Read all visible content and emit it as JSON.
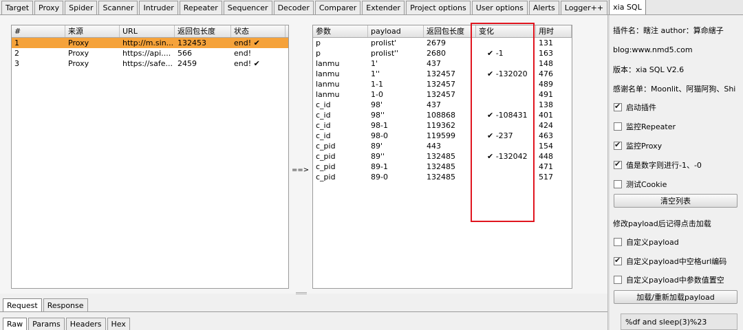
{
  "top_tabs": [
    "Target",
    "Proxy",
    "Spider",
    "Scanner",
    "Intruder",
    "Repeater",
    "Sequencer",
    "Decoder",
    "Comparer",
    "Extender",
    "Project options",
    "User options",
    "Alerts",
    "Logger++",
    "xia SQL"
  ],
  "left_table": {
    "columns": [
      "#",
      "来源",
      "URL",
      "返回包长度",
      "状态"
    ],
    "rows": [
      {
        "id": "1",
        "source": "Proxy",
        "url": "http://m.sin...",
        "length": "132453",
        "status": "end! ✔"
      },
      {
        "id": "2",
        "source": "Proxy",
        "url": "https://api....",
        "length": "566",
        "status": "end!"
      },
      {
        "id": "3",
        "source": "Proxy",
        "url": "https://safe...",
        "length": "2459",
        "status": "end! ✔"
      }
    ]
  },
  "arrow": "==>",
  "right_table": {
    "columns": [
      "参数",
      "payload",
      "返回包长度",
      "变化",
      "用时"
    ],
    "rows": [
      {
        "param": "p",
        "payload": "prolist'",
        "length": "2679",
        "change": "",
        "time": "131"
      },
      {
        "param": "p",
        "payload": "prolist''",
        "length": "2680",
        "change": "✔ -1",
        "time": "163"
      },
      {
        "param": "lanmu",
        "payload": "1'",
        "length": "437",
        "change": "",
        "time": "148"
      },
      {
        "param": "lanmu",
        "payload": "1''",
        "length": "132457",
        "change": "✔ -132020",
        "time": "476"
      },
      {
        "param": "lanmu",
        "payload": "1-1",
        "length": "132457",
        "change": "",
        "time": "489"
      },
      {
        "param": "lanmu",
        "payload": "1-0",
        "length": "132457",
        "change": "",
        "time": "491"
      },
      {
        "param": "c_id",
        "payload": "98'",
        "length": "437",
        "change": "",
        "time": "138"
      },
      {
        "param": "c_id",
        "payload": "98''",
        "length": "108868",
        "change": "✔ -108431",
        "time": "401"
      },
      {
        "param": "c_id",
        "payload": "98-1",
        "length": "119362",
        "change": "",
        "time": "424"
      },
      {
        "param": "c_id",
        "payload": "98-0",
        "length": "119599",
        "change": "✔ -237",
        "time": "463"
      },
      {
        "param": "c_pid",
        "payload": "89'",
        "length": "443",
        "change": "",
        "time": "154"
      },
      {
        "param": "c_pid",
        "payload": "89''",
        "length": "132485",
        "change": "✔ -132042",
        "time": "448"
      },
      {
        "param": "c_pid",
        "payload": "89-1",
        "length": "132485",
        "change": "",
        "time": "471"
      },
      {
        "param": "c_pid",
        "payload": "89-0",
        "length": "132485",
        "change": "",
        "time": "517"
      }
    ]
  },
  "request_tabs": [
    "Request",
    "Response"
  ],
  "sub_tabs": [
    "Raw",
    "Params",
    "Headers",
    "Hex"
  ],
  "panel": {
    "plugin_info": "插件名：瞎注 author：算命縖子",
    "blog": "blog:www.nmd5.com",
    "version": "版本：xia SQL V2.6",
    "thanks": "感谢名单：Moonlit、阿猫阿狗、Shi",
    "cb_enable": {
      "label": "启动插件",
      "checked": true
    },
    "cb_repeater": {
      "label": "监控Repeater",
      "checked": false
    },
    "cb_proxy": {
      "label": "监控Proxy",
      "checked": true
    },
    "cb_numeric": {
      "label": "值是数字则进行-1、-0",
      "checked": true
    },
    "cb_cookie": {
      "label": "测试Cookie",
      "checked": false
    },
    "clear_button": "清空列表",
    "hint": "修改payload后记得点击加载",
    "cb_custom": {
      "label": "自定义payload",
      "checked": false
    },
    "cb_urlencode": {
      "label": "自定义payload中空格url编码",
      "checked": true
    },
    "cb_empty": {
      "label": "自定义payload中参数值置空",
      "checked": false
    },
    "load_button": "加载/重新加载payload",
    "payload_text": "%df and sleep(3)%23"
  },
  "colors": {
    "selected_row": "#f5a23a",
    "highlight_box": "#e0141e"
  }
}
